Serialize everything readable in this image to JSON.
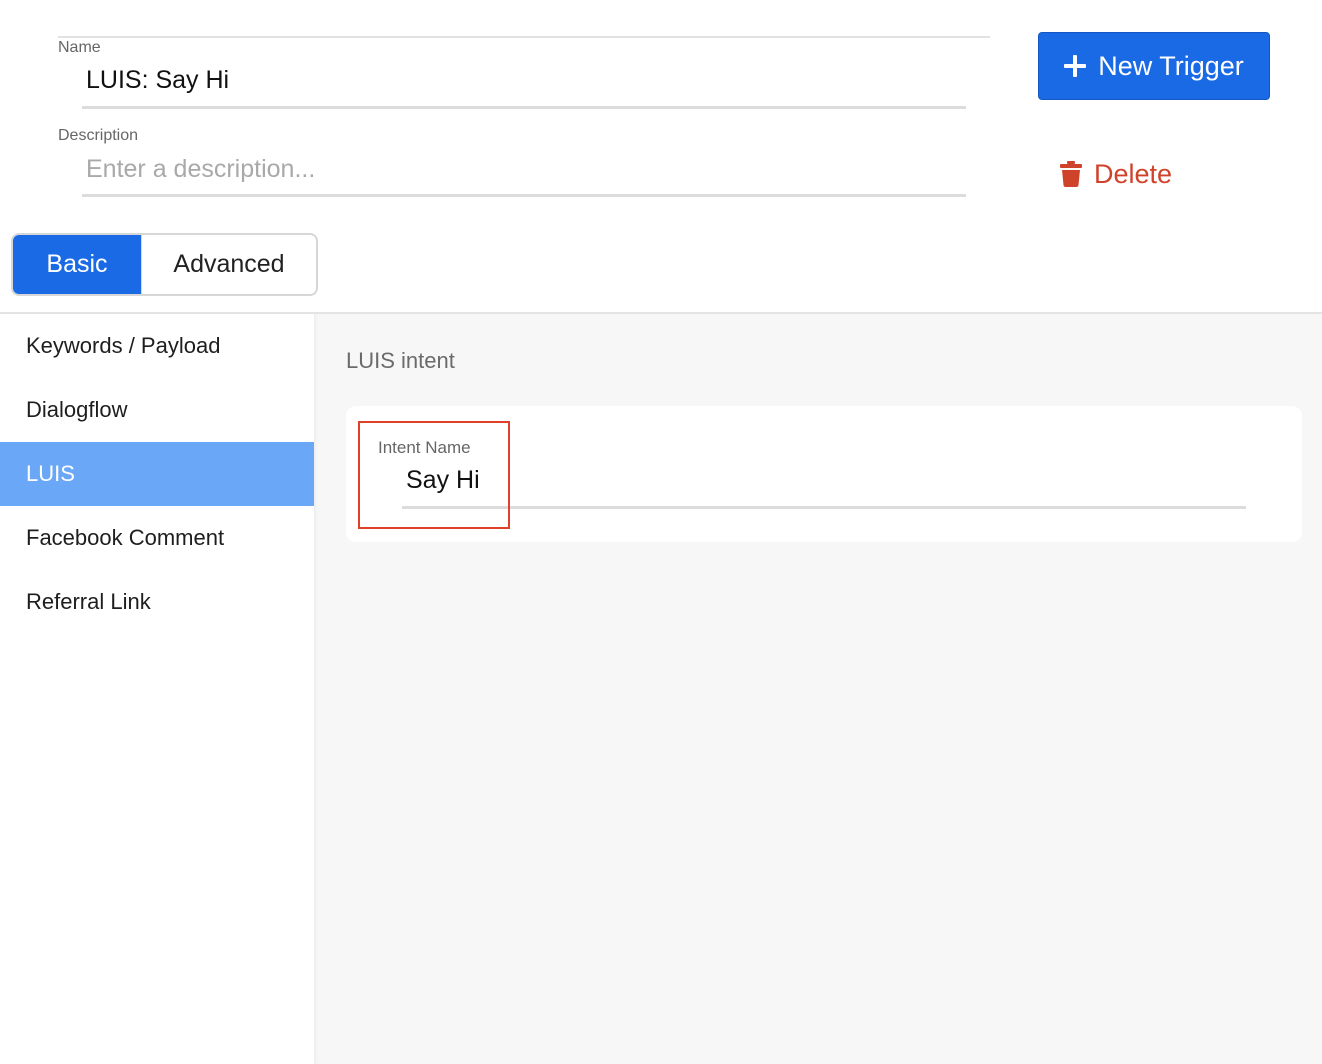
{
  "form": {
    "name_label": "Name",
    "name_value": "LUIS: Say Hi",
    "description_label": "Description",
    "description_placeholder": "Enter a description...",
    "description_value": ""
  },
  "actions": {
    "new_trigger_label": "New Trigger",
    "new_trigger_icon": "plus-icon",
    "delete_label": "Delete",
    "delete_icon": "trash-icon"
  },
  "tabs": [
    {
      "label": "Basic",
      "selected": true
    },
    {
      "label": "Advanced",
      "selected": false
    }
  ],
  "sidebar": {
    "items": [
      {
        "label": "Keywords / Payload",
        "active": false
      },
      {
        "label": "Dialogflow",
        "active": false
      },
      {
        "label": "LUIS",
        "active": true
      },
      {
        "label": "Facebook Comment",
        "active": false
      },
      {
        "label": "Referral Link",
        "active": false
      }
    ]
  },
  "main": {
    "section_title": "LUIS intent",
    "intent_label": "Intent Name",
    "intent_value": "Say Hi"
  },
  "colors": {
    "primary": "#1a6ae6",
    "sidebar_active": "#6aa8f7",
    "danger": "#d0432b",
    "highlight": "#e0402a"
  }
}
